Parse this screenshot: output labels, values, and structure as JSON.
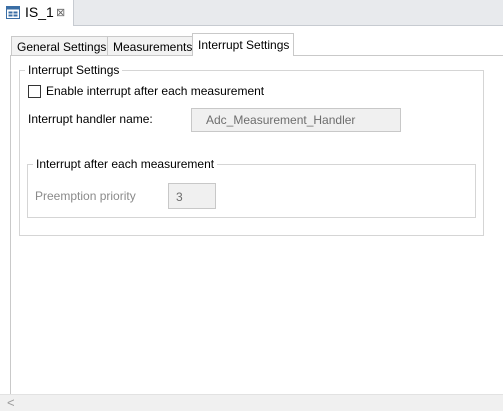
{
  "editor": {
    "tab_title": "IS_1",
    "tab_icon": "editor-form-icon",
    "close_icon": "close-icon",
    "close_glyph": "⊠"
  },
  "page_tabs": [
    {
      "label": "General Settings",
      "active": false
    },
    {
      "label": "Measurements",
      "active": false
    },
    {
      "label": "Interrupt  Settings",
      "active": true
    }
  ],
  "interrupt_settings": {
    "group_title": "Interrupt Settings",
    "enable_checkbox": {
      "label": "Enable interrupt after each measurement",
      "checked": false
    },
    "handler": {
      "label": "Interrupt handler name:",
      "value": "Adc_Measurement_Handler"
    },
    "sub_group": {
      "title": "Interrupt after each measurement",
      "preemption": {
        "label": "Preemption priority",
        "value": "3"
      }
    }
  },
  "scrollbar": {
    "left_arrow": "<"
  },
  "colors": {
    "tabbar_bg": "#e8eaed",
    "disabled_text": "#8a8a8a",
    "disabled_field_bg": "#f0f0f0"
  }
}
